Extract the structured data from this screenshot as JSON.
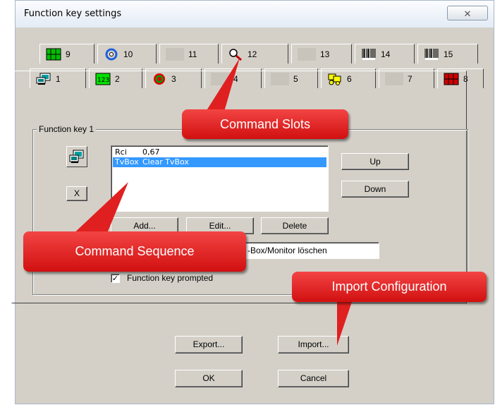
{
  "window": {
    "title": "Function key settings",
    "close_glyph": "☒"
  },
  "tabs_row_top": [
    {
      "number": "9",
      "icon": "green-grid-icon"
    },
    {
      "number": "10",
      "icon": "blue-swirl-icon"
    },
    {
      "number": "11",
      "icon": "blank-icon"
    },
    {
      "number": "12",
      "icon": "magnifier-icon"
    },
    {
      "number": "13",
      "icon": "blank-icon"
    },
    {
      "number": "14",
      "icon": "barcode-icon"
    },
    {
      "number": "15",
      "icon": "barcode-icon"
    }
  ],
  "tabs_row_bottom": [
    {
      "number": "1",
      "icon": "monitor-icon"
    },
    {
      "number": "2",
      "icon": "123-icon"
    },
    {
      "number": "3",
      "icon": "target-icon"
    },
    {
      "number": "4",
      "icon": "blank-icon"
    },
    {
      "number": "5",
      "icon": "blank-icon"
    },
    {
      "number": "6",
      "icon": "yellow-boxes-icon"
    },
    {
      "number": "7",
      "icon": "blank-icon"
    },
    {
      "number": "8",
      "icon": "red-grid-icon"
    }
  ],
  "group": {
    "label": "Function key 1"
  },
  "side_buttons": {
    "clear_label": "X"
  },
  "command_list": [
    {
      "name": "Rci",
      "value": "0,67",
      "selected": false
    },
    {
      "name": "TvBox",
      "value": "Clear TvBox",
      "selected": true
    }
  ],
  "buttons": {
    "up": "Up",
    "down": "Down",
    "add": "Add...",
    "edit": "Edit...",
    "delete": "Delete",
    "export": "Export...",
    "import": "Import...",
    "ok": "OK",
    "cancel": "Cancel"
  },
  "description_field": {
    "value": "-Box/Monitor löschen"
  },
  "prompted_checkbox": {
    "checked": true,
    "label": "Function key prompted"
  },
  "callouts": {
    "command_slots": "Command Slots",
    "command_sequence": "Command Sequence",
    "import_configuration": "Import Configuration"
  },
  "colors": {
    "callout_red": "#e02020",
    "selection_blue": "#3399ff",
    "dialog_face": "#d4d0c8"
  }
}
